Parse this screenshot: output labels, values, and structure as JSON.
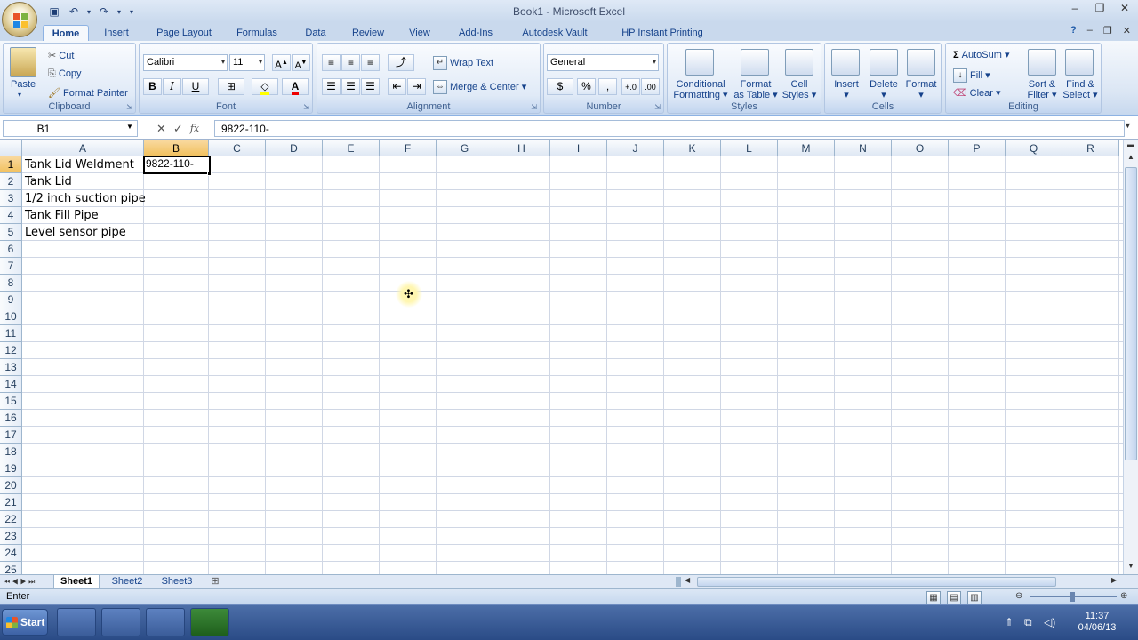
{
  "window": {
    "title": "Book1 - Microsoft Excel"
  },
  "tabs": [
    "Home",
    "Insert",
    "Page Layout",
    "Formulas",
    "Data",
    "Review",
    "View",
    "Add-Ins",
    "Autodesk Vault",
    "HP Instant Printing"
  ],
  "ribbon": {
    "clipboard": {
      "label": "Clipboard",
      "paste": "Paste",
      "cut": "Cut",
      "copy": "Copy",
      "format_painter": "Format Painter"
    },
    "font": {
      "label": "Font",
      "font_name": "Calibri",
      "font_size": "11",
      "bold": "B",
      "italic": "I",
      "underline": "U"
    },
    "alignment": {
      "label": "Alignment",
      "wrap_text": "Wrap Text",
      "merge_center": "Merge & Center"
    },
    "number": {
      "label": "Number",
      "format": "General",
      "percent": "%",
      "comma": ","
    },
    "styles": {
      "label": "Styles",
      "conditional_formatting_1": "Conditional",
      "conditional_formatting_2": "Formatting",
      "format_table_1": "Format",
      "format_table_2": "as Table",
      "cell_styles_1": "Cell",
      "cell_styles_2": "Styles"
    },
    "cells": {
      "label": "Cells",
      "insert": "Insert",
      "delete": "Delete",
      "format": "Format"
    },
    "editing": {
      "label": "Editing",
      "autosum": "AutoSum",
      "fill": "Fill",
      "clear": "Clear",
      "sort_filter_1": "Sort &",
      "sort_filter_2": "Filter",
      "find_select_1": "Find &",
      "find_select_2": "Select"
    }
  },
  "formula_bar": {
    "name_box": "B1",
    "fx": "fx",
    "formula": "9822-110-"
  },
  "columns": [
    "A",
    "B",
    "C",
    "D",
    "E",
    "F",
    "G",
    "H",
    "I",
    "J",
    "K",
    "L",
    "M",
    "N",
    "O",
    "P",
    "Q",
    "R"
  ],
  "rows": [
    "1",
    "2",
    "3",
    "4",
    "5",
    "6",
    "7",
    "8",
    "9",
    "10",
    "11",
    "12",
    "13",
    "14",
    "15",
    "16",
    "17",
    "18",
    "19",
    "20",
    "21",
    "22",
    "23",
    "24",
    "25"
  ],
  "cells": {
    "A1": "Tank Lid Weldment",
    "A2": "Tank Lid",
    "A3": "1/2 inch suction pipe",
    "A4": "Tank Fill Pipe",
    "A5": "Level sensor pipe",
    "B1": "9822-110-"
  },
  "sheets": [
    "Sheet1",
    "Sheet2",
    "Sheet3"
  ],
  "status": {
    "mode": "Enter"
  },
  "taskbar": {
    "start": "Start",
    "clock_time": "11:37",
    "clock_date": "04/06/13"
  },
  "colors": {
    "ribbon_bg": "#dbe6f4",
    "selected_header": "#f1c15f",
    "taskbar": "#2a4b86"
  }
}
